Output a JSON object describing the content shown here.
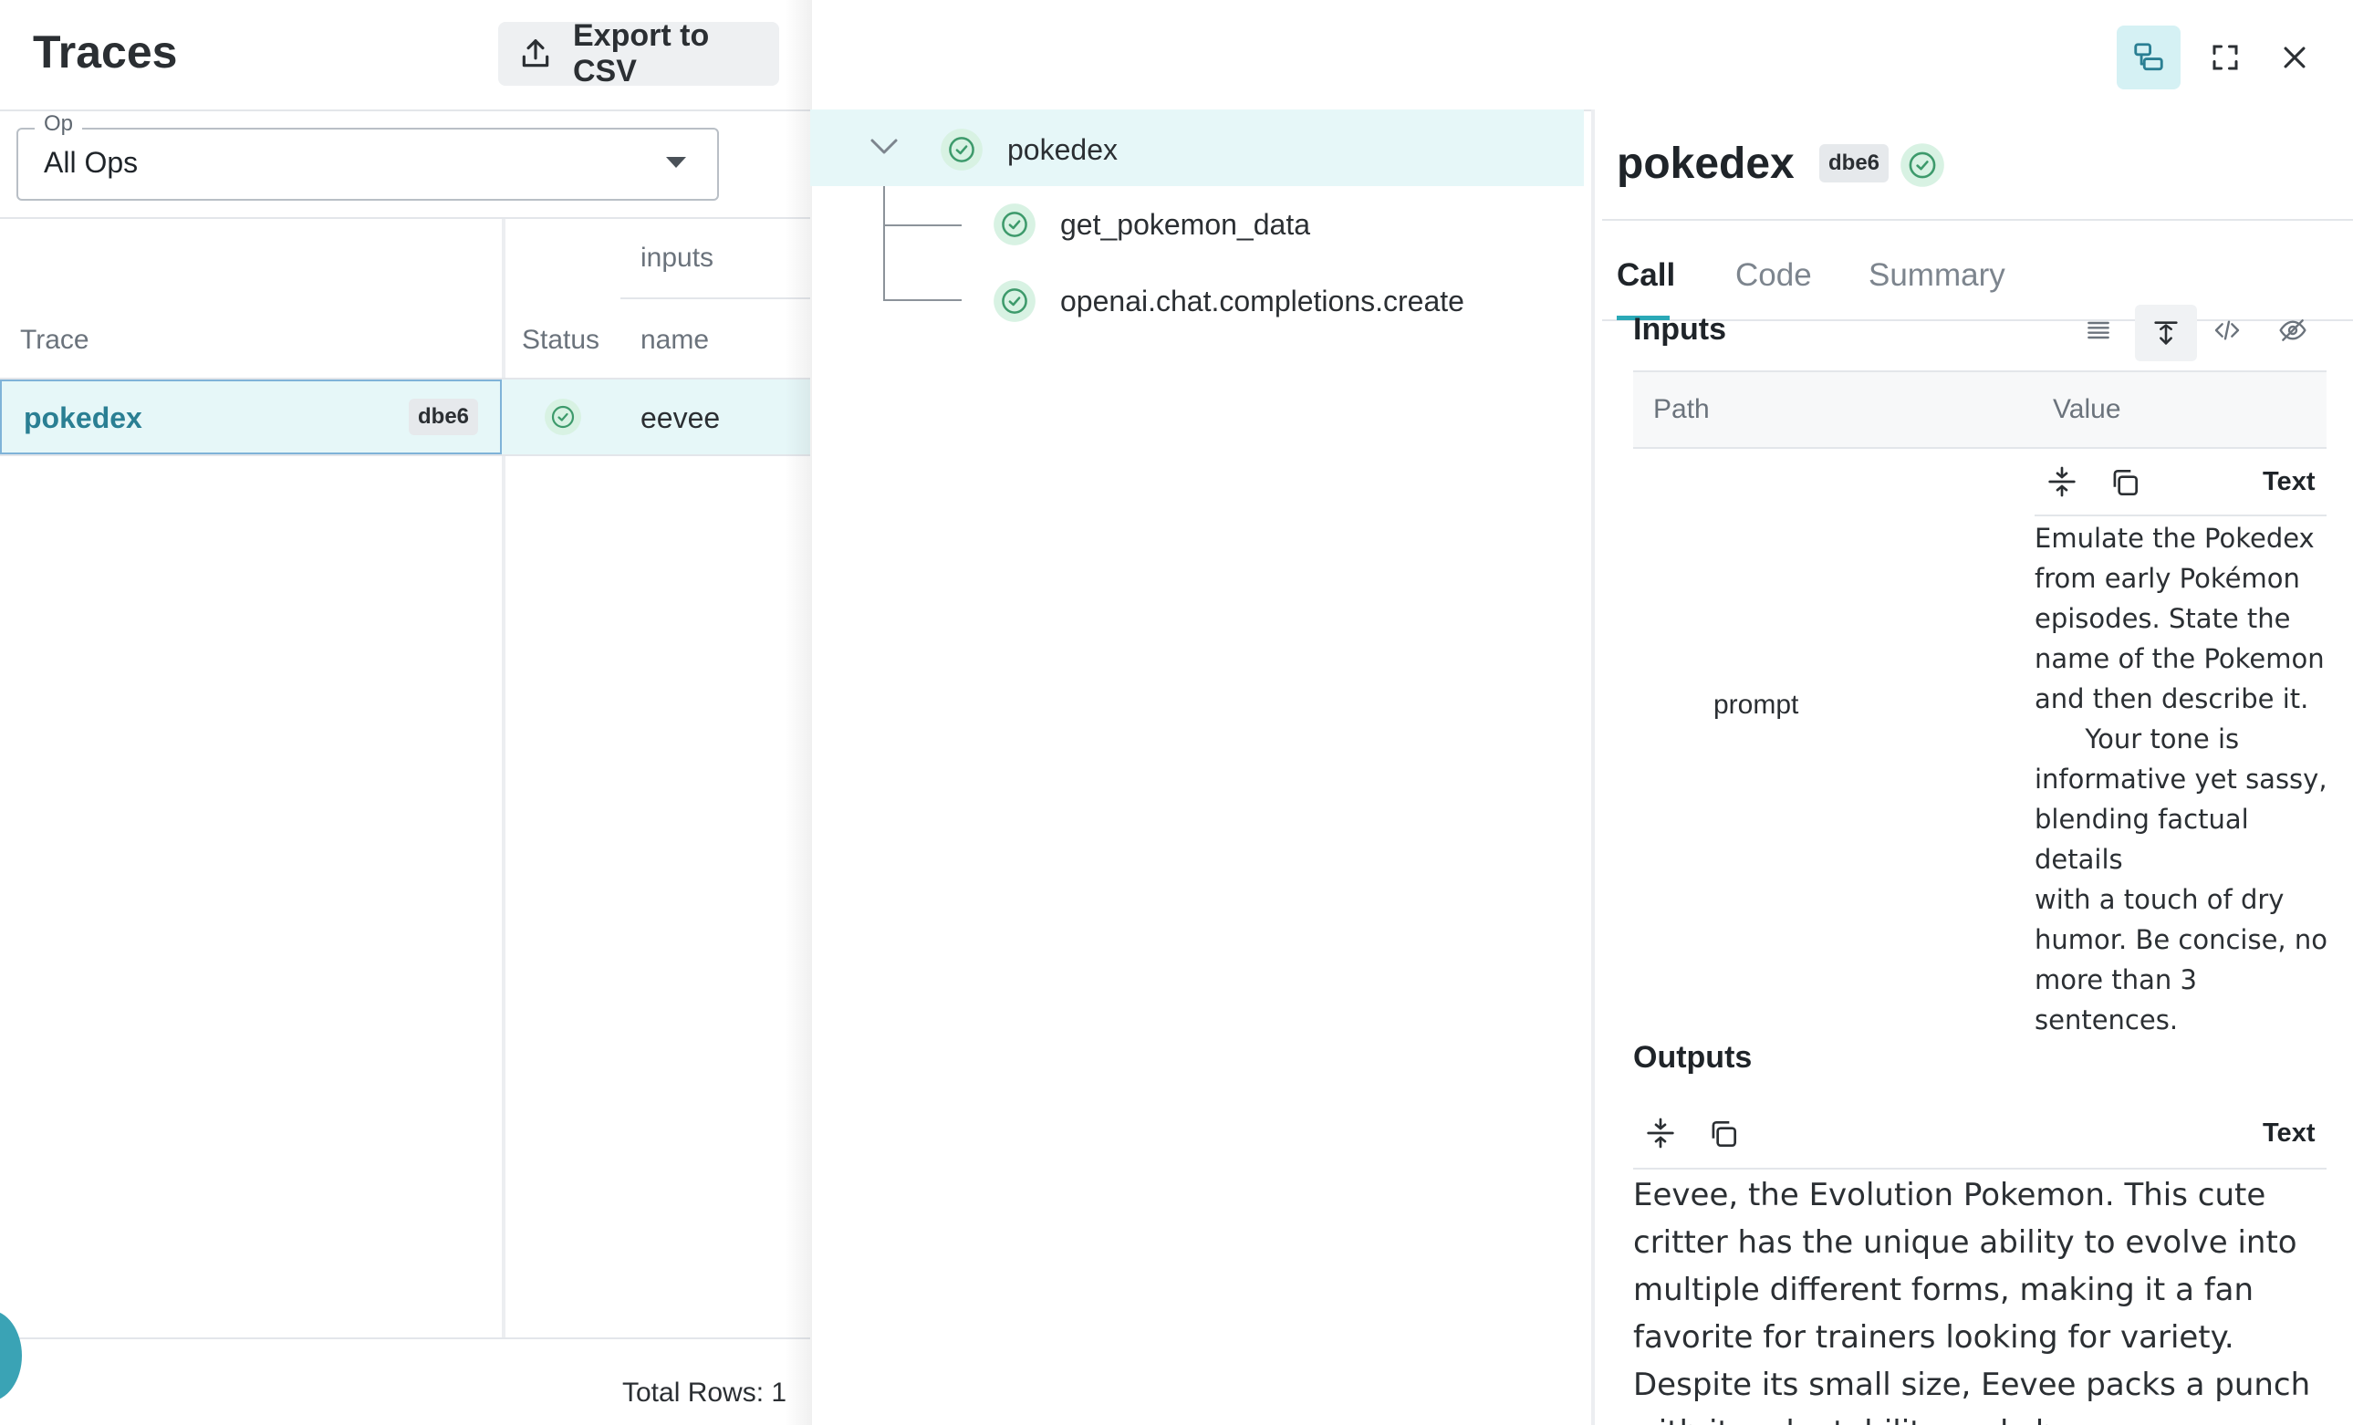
{
  "left_panel": {
    "title": "Traces",
    "export_label": "Export to CSV",
    "op_filter": {
      "label": "Op",
      "value": "All Ops"
    },
    "table": {
      "group_header": "inputs",
      "columns": [
        "Trace",
        "Status",
        "name"
      ],
      "rows": [
        {
          "trace": "pokedex",
          "badge": "dbe6",
          "status": "success",
          "name": "eevee"
        }
      ]
    },
    "total_rows": "Total Rows: 1"
  },
  "tree": {
    "root": {
      "label": "pokedex",
      "status": "success",
      "expanded": true
    },
    "children": [
      {
        "label": "get_pokemon_data",
        "status": "success"
      },
      {
        "label": "openai.chat.completions.create",
        "status": "success"
      }
    ]
  },
  "detail": {
    "title": "pokedex",
    "badge": "dbe6",
    "status": "success",
    "tabs": [
      "Call",
      "Code",
      "Summary"
    ],
    "active_tab": "Call",
    "inputs": {
      "title": "Inputs",
      "columns": {
        "path": "Path",
        "value": "Value"
      },
      "value_format": "Text",
      "rows": [
        {
          "path": "prompt",
          "value": "Emulate the Pokedex\nfrom early Pokémon\nepisodes. State the\nname of the Pokemon\nand then describe it.\n      Your tone is\ninformative yet sassy,\nblending factual details\nwith a touch of dry\nhumor. Be concise, no\nmore than 3 sentences."
        }
      ]
    },
    "outputs": {
      "title": "Outputs",
      "value_format": "Text",
      "value": "Eevee, the Evolution Pokemon. This cute critter has the unique ability to evolve into multiple different forms, making it a fan favorite for trainers looking for variety. Despite its small size, Eevee packs a punch with its adaptability and charm."
    }
  },
  "icons": {
    "export": "upload-icon",
    "op_caret": "caret-down-icon",
    "tree_chevron": "chevron-down-icon",
    "status": "check-circle-icon",
    "tree_view": "tree-view-icon",
    "fullscreen": "fullscreen-icon",
    "close": "close-icon",
    "list": "list-icon",
    "expand": "expand-icon",
    "code": "code-icon",
    "hide": "eye-off-icon",
    "collapse": "collapse-icon",
    "copy": "copy-icon"
  },
  "colors": {
    "accent": "#2aa9b7",
    "selected_row": "#e6f7f8",
    "success": "#3d9a6b",
    "success_bg": "#d8f2e3",
    "link": "#2a7f93"
  }
}
